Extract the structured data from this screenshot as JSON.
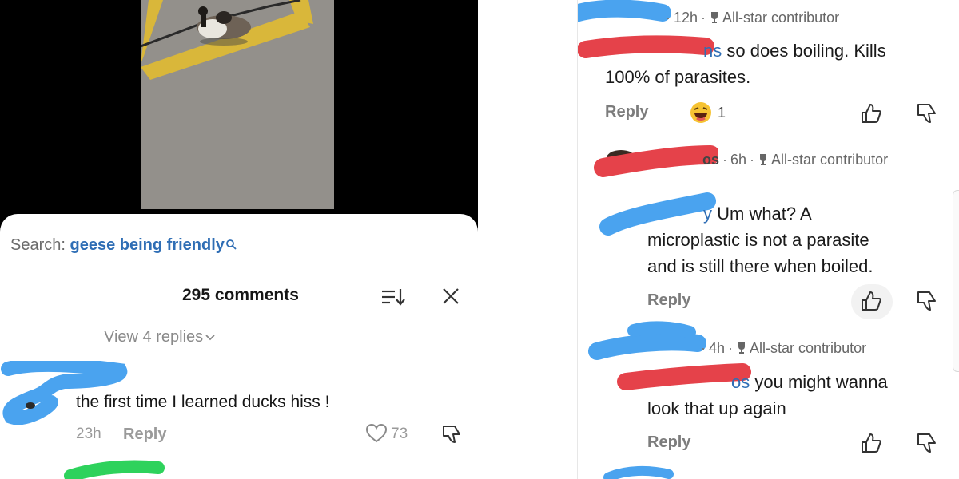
{
  "left": {
    "search": {
      "prefix": "Search:",
      "query": "geese being friendly"
    },
    "header": {
      "comments_count": "295 comments"
    },
    "thread": {
      "view_replies": "View 4 replies"
    },
    "comment": {
      "text": "the first time I learned ducks hiss !",
      "time": "23h",
      "reply_label": "Reply",
      "likes": "73"
    }
  },
  "right": {
    "comments": [
      {
        "time": "12h",
        "badge": "All-star contributor",
        "mention": "ns",
        "text_line1": " so does boiling. Kills",
        "text_line2": "100% of parasites.",
        "reply_label": "Reply",
        "reaction_count": "1"
      },
      {
        "name_tail": "os",
        "time": "6h",
        "badge": "All-star contributor",
        "mention": "y",
        "text_line1": " Um what? A",
        "text_line2": "microplastic is not a parasite",
        "text_line3": "and is still there when boiled.",
        "reply_label": "Reply"
      },
      {
        "time": "4h",
        "badge": "All-star contributor",
        "mention": "os",
        "text_line1": " you might wanna",
        "text_line2": "look that up again",
        "reply_label": "Reply"
      }
    ]
  },
  "colors": {
    "link_blue": "#2f6eb5",
    "redact_blue": "#4aa3ef",
    "redact_red": "#e5424a",
    "redact_green": "#2ed25c"
  },
  "icons": [
    "magnifier-icon",
    "sort-icon",
    "close-icon",
    "chevron-down-icon",
    "heart-icon",
    "thumbs-up-icon",
    "thumbs-down-icon",
    "trophy-icon",
    "laughing-emoji-icon"
  ]
}
